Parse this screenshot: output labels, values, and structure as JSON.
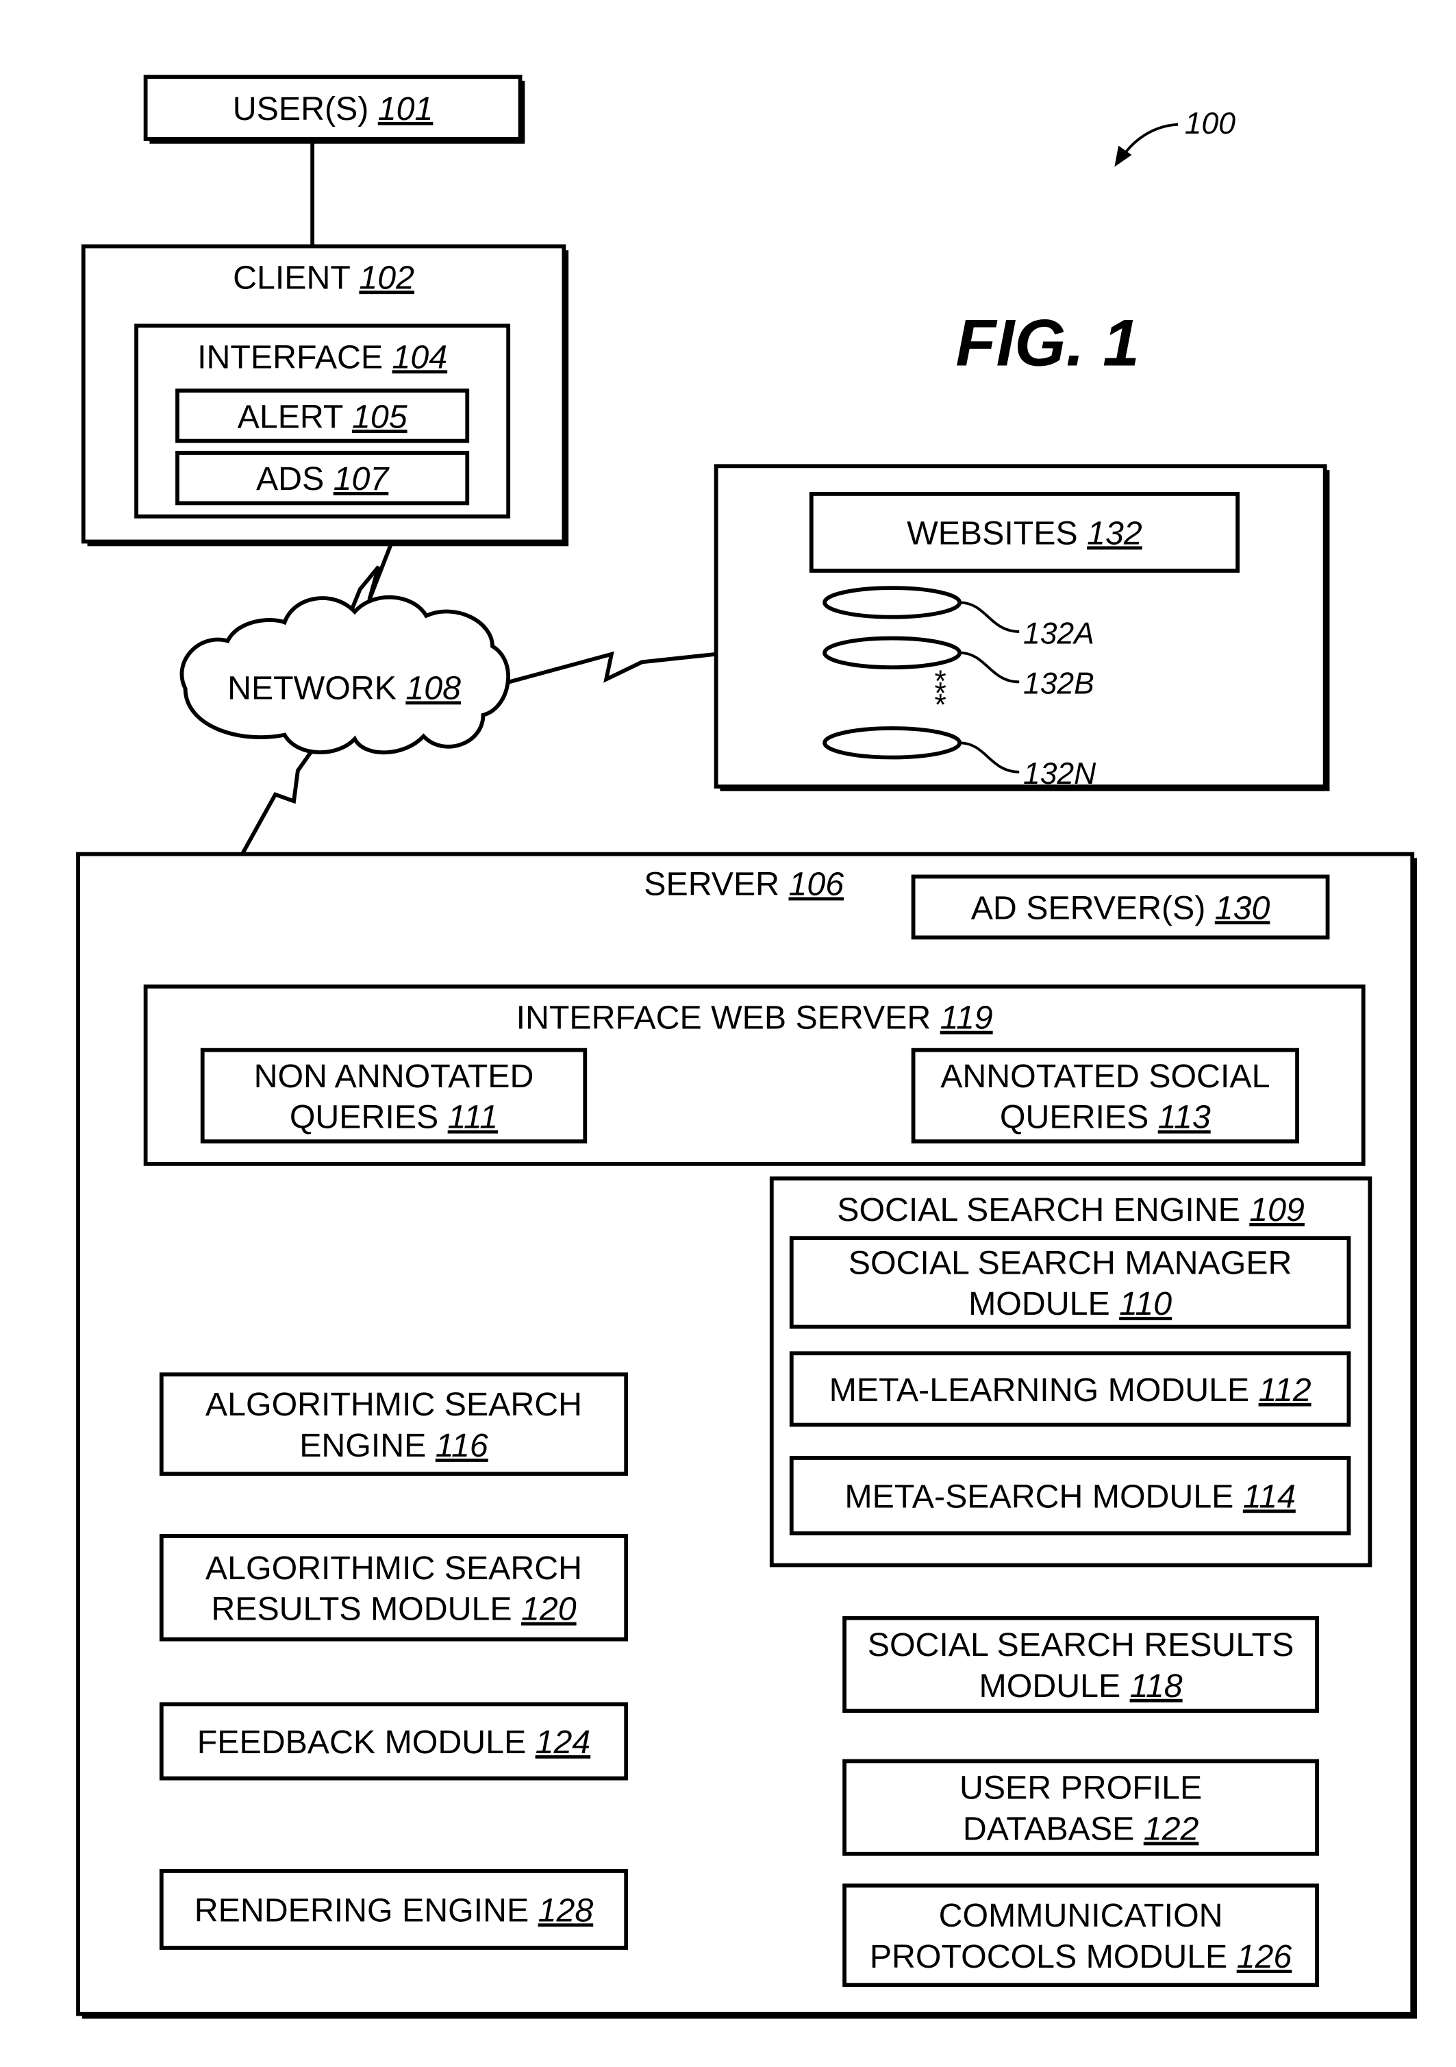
{
  "figure": {
    "title": "FIG. 1",
    "reference": "100"
  },
  "nodes": {
    "users": {
      "text": "USER(S)",
      "num": "101"
    },
    "client": {
      "text": "CLIENT",
      "num": "102"
    },
    "interface": {
      "text": "INTERFACE",
      "num": "104"
    },
    "alert": {
      "text": "ALERT",
      "num": "105"
    },
    "ads": {
      "text": "ADS",
      "num": "107"
    },
    "network": {
      "text": "NETWORK",
      "num": "108"
    },
    "websites_container": {
      "text": "",
      "num": ""
    },
    "websites": {
      "text": "WEBSITES",
      "num": "132"
    },
    "server": {
      "text": "SERVER",
      "num": "106"
    },
    "ad_servers": {
      "text": "AD  SERVER(S)",
      "num": "130"
    },
    "interface_web_server": {
      "text": "INTERFACE WEB SERVER ",
      "num": "119"
    },
    "non_annotated_queries": {
      "lines": [
        "NON ANNOTATED",
        "QUERIES"
      ],
      "num": "111"
    },
    "annotated_social_queries": {
      "lines": [
        "ANNOTATED SOCIAL",
        "QUERIES"
      ],
      "num": "113"
    },
    "social_search_engine": {
      "text": "SOCIAL SEARCH ENGINE",
      "num": "109"
    },
    "social_search_manager": {
      "lines": [
        "SOCIAL SEARCH MANAGER",
        "MODULE"
      ],
      "num": "110"
    },
    "meta_learning": {
      "text": "META-LEARNING MODULE",
      "num": "112"
    },
    "meta_search": {
      "text": "META-SEARCH MODULE",
      "num": "114"
    },
    "algorithmic_search_engine": {
      "lines": [
        "ALGORITHMIC SEARCH",
        "ENGINE"
      ],
      "num": "116"
    },
    "algorithmic_search_results": {
      "lines": [
        "ALGORITHMIC SEARCH",
        "RESULTS MODULE"
      ],
      "num": "120"
    },
    "feedback_module": {
      "text": "FEEDBACK MODULE",
      "num": "124"
    },
    "rendering_engine": {
      "text": "RENDERING ENGINE",
      "num": "128"
    },
    "social_search_results": {
      "lines": [
        "SOCIAL SEARCH RESULTS",
        "MODULE"
      ],
      "num": "118"
    },
    "user_profile_db": {
      "lines": [
        "USER PROFILE",
        "DATABASE"
      ],
      "num": "122"
    },
    "communication_protocols": {
      "lines": [
        "COMMUNICATION",
        "PROTOCOLS MODULE"
      ],
      "num": "126"
    }
  },
  "websites_list": [
    {
      "label": "132A"
    },
    {
      "label": "132B"
    },
    {
      "label": "132N"
    }
  ],
  "ellipsis_marks": "* * *"
}
